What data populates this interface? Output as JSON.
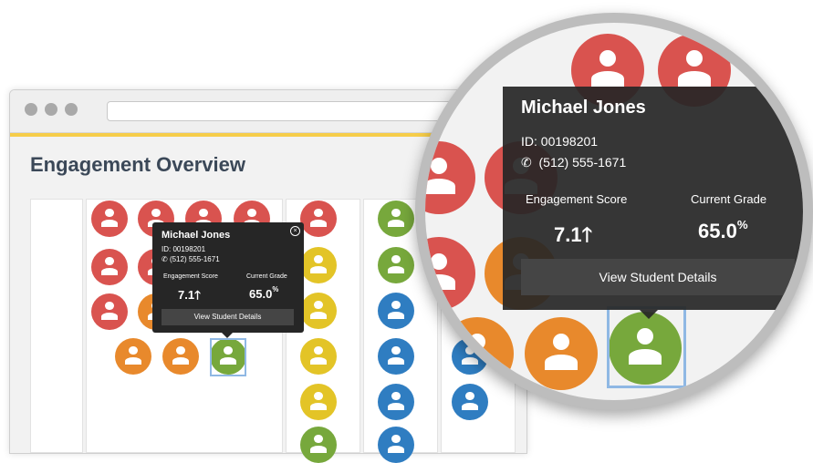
{
  "colors": {
    "red": "#d9534f",
    "orange": "#e8892c",
    "yellow": "#e3c427",
    "green": "#77a83c",
    "blue": "#2f7dc1",
    "accent": "#f6cd4a",
    "tooltip_bg": "#262626"
  },
  "page": {
    "title": "Engagement Overview"
  },
  "student_tooltip": {
    "name": "Michael Jones",
    "id": "ID: 00198201",
    "phone": "(512) 555-1671",
    "phone_icon": "phone-icon",
    "engagement_label": "Engagement Score",
    "engagement_value": "7.1",
    "trend_icon": "arrow-up-icon",
    "grade_label": "Current Grade",
    "grade_value": "65.0",
    "grade_unit": "%",
    "details_button": "View Student Details",
    "close_icon": "close-icon"
  }
}
